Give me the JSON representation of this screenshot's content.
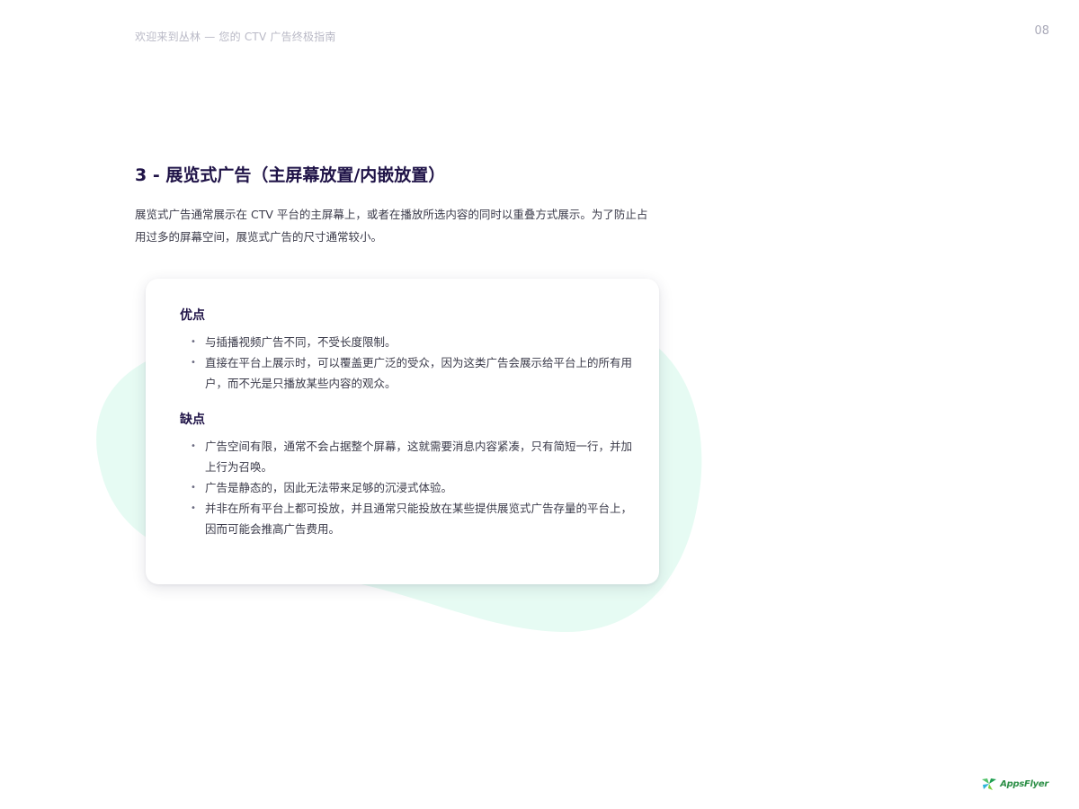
{
  "header": {
    "title": "欢迎来到丛林 — 您的 CTV 广告终极指南",
    "page_number": "08"
  },
  "section": {
    "heading": "3 - 展览式广告（主屏幕放置/内嵌放置）",
    "intro": "展览式广告通常展示在 CTV 平台的主屏幕上，或者在播放所选内容的同时以重叠方式展示。为了防止占用过多的屏幕空间，展览式广告的尺寸通常较小。"
  },
  "card": {
    "pros_heading": "优点",
    "pros": [
      "与插播视频广告不同，不受长度限制。",
      "直接在平台上展示时，可以覆盖更广泛的受众，因为这类广告会展示给平台上的所有用户，而不光是只播放某些内容的观众。"
    ],
    "cons_heading": "缺点",
    "cons": [
      "广告空间有限，通常不会占据整个屏幕，这就需要消息内容紧凑，只有简短一行，并加上行为召唤。",
      "广告是静态的，因此无法带来足够的沉浸式体验。",
      "并非在所有平台上都可投放，并且通常只能投放在某些提供展览式广告存量的平台上，因而可能会推高广告费用。"
    ],
    "bullet": "•"
  },
  "logo": {
    "text": "AppsFlyer",
    "icon": "appsflyer-leaf-icon"
  },
  "colors": {
    "heading": "#1f1347",
    "blob": "#e6fbf3",
    "logo_green": "#2d8f47"
  }
}
